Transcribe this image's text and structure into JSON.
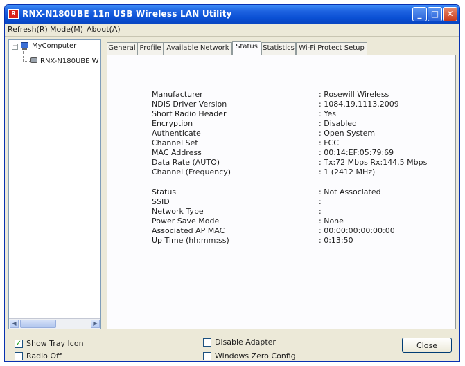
{
  "window": {
    "title": "RNX-N180UBE 11n USB Wireless LAN Utility",
    "app_icon_text": "R",
    "controls": {
      "minimize": "_",
      "maximize": "□",
      "close": "✕"
    }
  },
  "menu": {
    "refresh": "Refresh(R)",
    "mode": "Mode(M)",
    "about": "About(A)"
  },
  "tree": {
    "root_label": "MyComputer",
    "child_label": "RNX-N180UBE W",
    "expand_symbol": "−",
    "scroll_left": "◀",
    "scroll_right": "▶"
  },
  "tabs": [
    {
      "label": "General"
    },
    {
      "label": "Profile"
    },
    {
      "label": "Available Network"
    },
    {
      "label": "Status"
    },
    {
      "label": "Statistics"
    },
    {
      "label": "Wi-Fi Protect Setup"
    }
  ],
  "active_tab": "Status",
  "status": {
    "separator": ":",
    "rows": [
      {
        "label": "Manufacturer",
        "value": "Rosewill Wireless"
      },
      {
        "label": "NDIS Driver Version",
        "value": "1084.19.1113.2009"
      },
      {
        "label": "Short Radio Header",
        "value": "Yes"
      },
      {
        "label": "Encryption",
        "value": "Disabled"
      },
      {
        "label": "Authenticate",
        "value": "Open System"
      },
      {
        "label": "Channel Set",
        "value": "FCC"
      },
      {
        "label": "MAC Address",
        "value": "00:14:EF:05:79:69"
      },
      {
        "label": "Data Rate (AUTO)",
        "value": "Tx:72 Mbps Rx:144.5 Mbps"
      },
      {
        "label": "Channel (Frequency)",
        "value": "1 (2412 MHz)"
      },
      {
        "label": "Status",
        "value": "Not Associated"
      },
      {
        "label": "SSID",
        "value": ""
      },
      {
        "label": "Network Type",
        "value": ""
      },
      {
        "label": "Power Save Mode",
        "value": "None"
      },
      {
        "label": "Associated AP MAC",
        "value": "00:00:00:00:00:00"
      },
      {
        "label": "Up Time (hh:mm:ss)",
        "value": "0:13:50"
      }
    ]
  },
  "options": {
    "show_tray_icon": {
      "label": "Show Tray Icon",
      "checked": true
    },
    "radio_off": {
      "label": "Radio Off",
      "checked": false
    },
    "disable_adapter": {
      "label": "Disable Adapter",
      "checked": false
    },
    "windows_zero_config": {
      "label": "Windows Zero Config",
      "checked": false
    }
  },
  "check_mark": "✓",
  "close_button": "Close",
  "colors": {
    "title_bar": "#0a50d4",
    "window_bg": "#ece9d8",
    "close_control": "#c83a1c",
    "app_icon": "#d9241c"
  }
}
